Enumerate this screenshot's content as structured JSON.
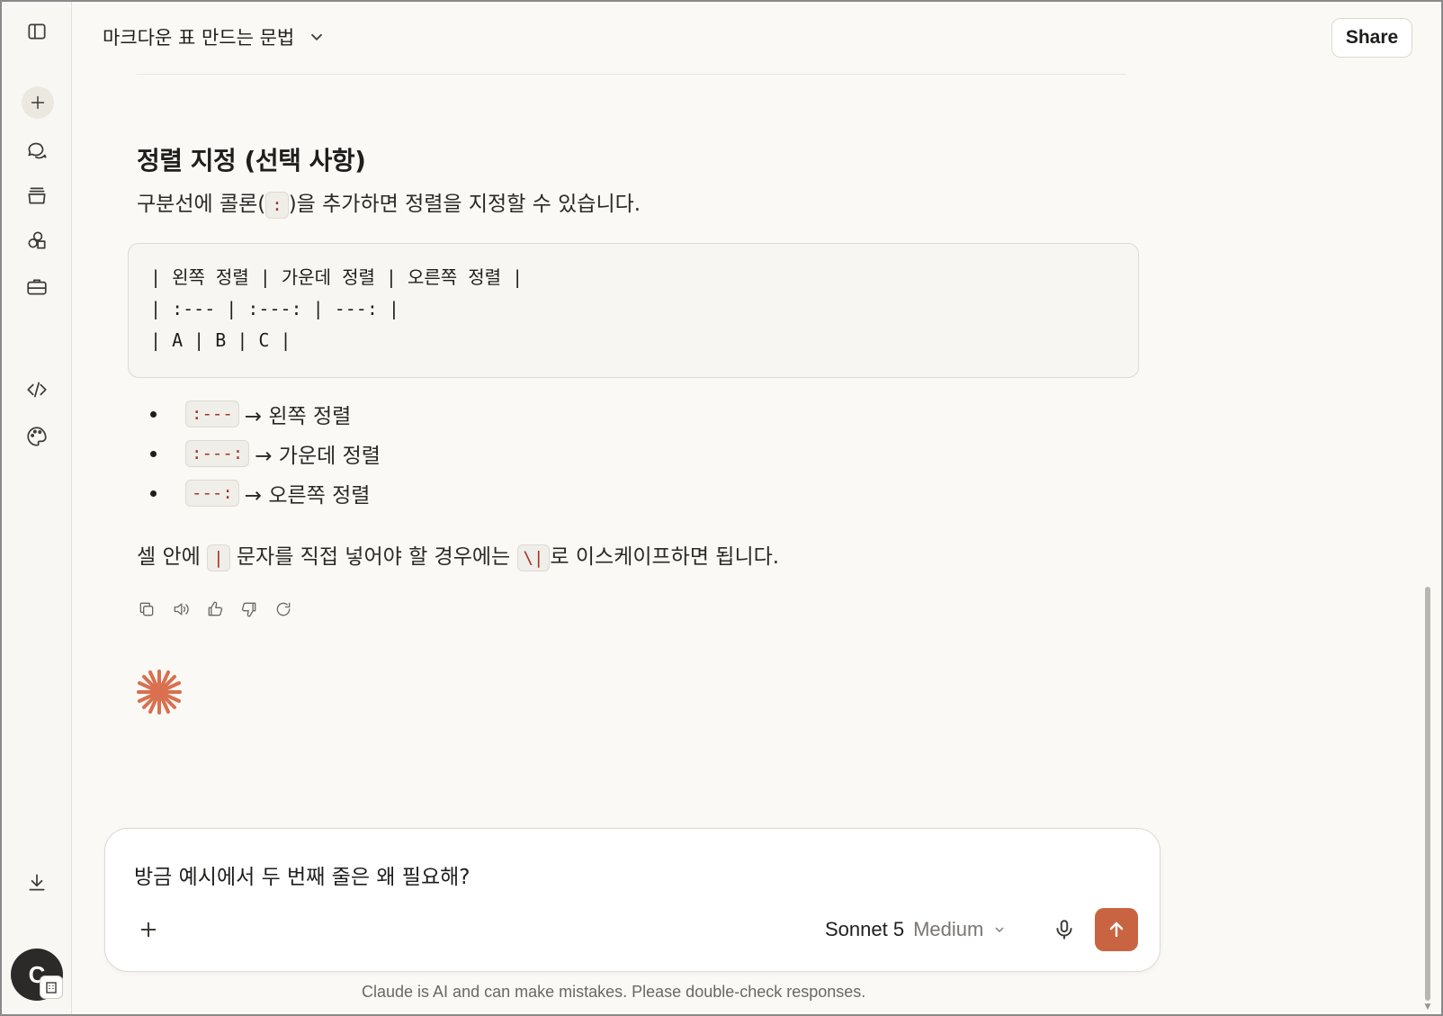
{
  "header": {
    "title": "마크다운 표 만드는 문법",
    "share_label": "Share"
  },
  "sidebar": {
    "items": [
      {
        "name": "toggle-sidebar",
        "icon": "sidebar-icon"
      },
      {
        "name": "new-chat",
        "icon": "plus-icon"
      },
      {
        "name": "chats",
        "icon": "chats-icon"
      },
      {
        "name": "projects",
        "icon": "projects-icon"
      },
      {
        "name": "artifacts",
        "icon": "artifacts-icon"
      },
      {
        "name": "tools",
        "icon": "briefcase-icon"
      },
      {
        "name": "code",
        "icon": "code-icon"
      },
      {
        "name": "design",
        "icon": "palette-icon"
      },
      {
        "name": "download",
        "icon": "download-icon"
      }
    ],
    "avatar_initial": "C"
  },
  "message": {
    "heading": "정렬 지정 (선택 사항)",
    "intro_before": "구분선에 콜론(",
    "intro_code": ":",
    "intro_after": ")을 추가하면 정렬을 지정할 수 있습니다.",
    "code_block": "| 왼쪽 정렬 | 가운데 정렬 | 오른쪽 정렬 |\n| :--- | :---: | ---: |\n| A | B | C |",
    "bullets": [
      {
        "code": ":---",
        "text": "→ 왼쪽 정렬"
      },
      {
        "code": ":---:",
        "text": "→ 가운데 정렬"
      },
      {
        "code": "---:",
        "text": "→ 오른쪽 정렬"
      }
    ],
    "escape_before": "셀 안에 ",
    "escape_code1": "|",
    "escape_middle": " 문자를 직접 넣어야 할 경우에는 ",
    "escape_code2": "\\|",
    "escape_after": "로 이스케이프하면 됩니다."
  },
  "actions": [
    "copy-icon",
    "speaker-icon",
    "thumbs-up-icon",
    "thumbs-down-icon",
    "retry-icon"
  ],
  "composer": {
    "input_value": "방금 예시에서 두 번째 줄은 왜 필요해?",
    "model_name": "Sonnet 5",
    "model_effort": "Medium"
  },
  "disclaimer": "Claude is AI and can make mistakes. Please double-check responses.",
  "colors": {
    "accent": "#c96442",
    "background": "#faf9f5",
    "code_text": "#a3322a"
  }
}
